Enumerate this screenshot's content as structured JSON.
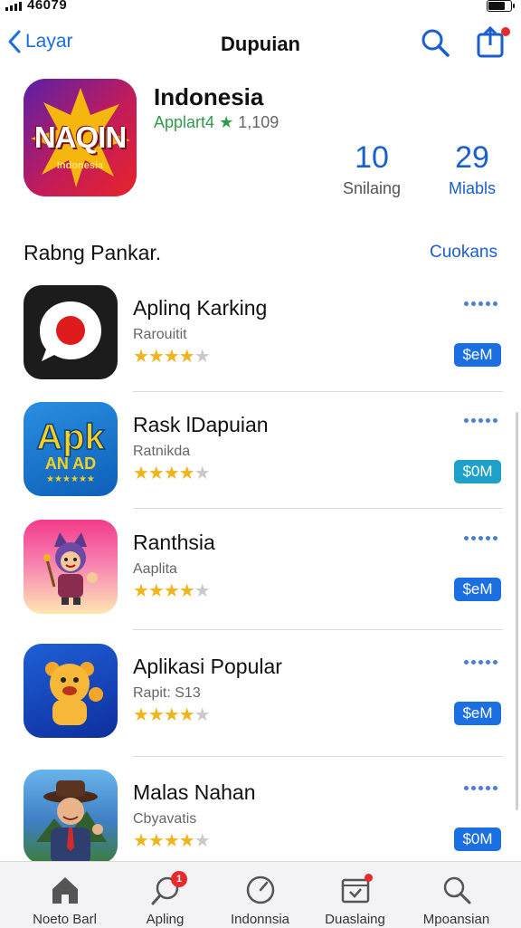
{
  "status_bar": {
    "carrier_text": "46079"
  },
  "nav": {
    "back_label": "Layar",
    "title": "Dupuian"
  },
  "featured": {
    "icon_text": "NAQIN",
    "icon_subtext": "Indonesia",
    "name": "Indonesia",
    "developer": "Applart4",
    "star_glyph": "★",
    "rating_count": "1,109",
    "stats": [
      {
        "value": "10",
        "label": "Snilaing"
      },
      {
        "value": "29",
        "label": "Miabls"
      }
    ]
  },
  "section": {
    "title": "Rabng Pankar.",
    "link": "Cuokans"
  },
  "apps": [
    {
      "name": "Aplinq Karking",
      "subtitle": "Rarouitit",
      "rating": 4.5,
      "get_label": "$eM",
      "icon": "red-circle-chat-icon",
      "button_color": "#1b6fe0"
    },
    {
      "name": "Rask lDapuian",
      "subtitle": "Ratnikda",
      "rating": 4.5,
      "get_label": "$0M",
      "icon": "apk-logo-icon",
      "button_color": "#1ea0c8"
    },
    {
      "name": "Ranthsia",
      "subtitle": "Aaplita",
      "rating": 4.5,
      "get_label": "$eM",
      "icon": "cartoon-character-icon",
      "button_color": "#1b6fe0"
    },
    {
      "name": "Aplikasi Popular",
      "subtitle": "Rapit: S13",
      "rating": 4.5,
      "get_label": "$eM",
      "icon": "bear-mascot-icon",
      "button_color": "#1b6fe0"
    },
    {
      "name": "Malas Nahan",
      "subtitle": "Cbyavatis",
      "rating": 4.5,
      "get_label": "$0M",
      "icon": "cowboy-avatar-icon",
      "button_color": "#1b6fe0"
    }
  ],
  "tabs": [
    {
      "label": "Noeto Barl",
      "icon": "home-icon"
    },
    {
      "label": "Apling",
      "icon": "search-bubble-icon",
      "badge": "1"
    },
    {
      "label": "Indonnsia",
      "icon": "compass-icon"
    },
    {
      "label": "Duaslaing",
      "icon": "inbox-icon"
    },
    {
      "label": "Mpoansian",
      "icon": "search-icon"
    }
  ],
  "colors": {
    "accent": "#1a5fcf",
    "badge": "#e52b2b",
    "star": "#f0b51c",
    "developer": "#2e9c4c"
  }
}
